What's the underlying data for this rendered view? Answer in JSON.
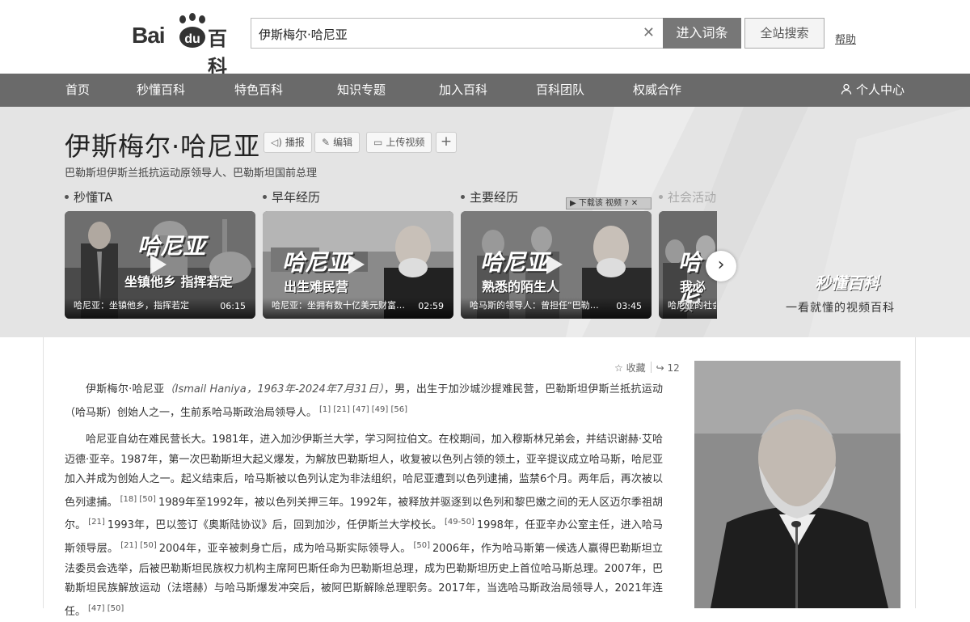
{
  "header": {
    "logo_text_bai": "Bai",
    "logo_text_du": "du",
    "logo_text_baike": "百科",
    "search_value": "伊斯梅尔·哈尼亚",
    "enter_entry_label": "进入词条",
    "site_search_label": "全站搜索",
    "help_label": "帮助"
  },
  "nav": {
    "items": [
      {
        "label": "首页"
      },
      {
        "label": "秒懂百科"
      },
      {
        "label": "特色百科"
      },
      {
        "label": "知识专题"
      },
      {
        "label": "加入百科"
      },
      {
        "label": "百科团队"
      },
      {
        "label": "权威合作"
      }
    ],
    "personal_center": "个人中心"
  },
  "entry": {
    "title": "伊斯梅尔·哈尼亚",
    "tools": {
      "broadcast": "播报",
      "edit": "编辑",
      "upload_video": "上传视频"
    },
    "subtitle": "巴勒斯坦伊斯兰抵抗运动原领导人、巴勒斯坦国前总理"
  },
  "video_section": {
    "tabs": [
      {
        "label": "秒懂TA"
      },
      {
        "label": "早年经历"
      },
      {
        "label": "主要经历"
      },
      {
        "label": "社会活动"
      }
    ],
    "download_ad": "下载该 视频",
    "cards": [
      {
        "overlay_title": "哈尼亚",
        "overlay_sub": "坐镇他乡 指挥若定",
        "caption": "哈尼亚：坐镇他乡，指挥若定",
        "duration": "06:15"
      },
      {
        "overlay_title": "哈尼亚",
        "overlay_sub": "出生难民营",
        "caption": "哈尼亚：坐拥有数十亿美元财富…",
        "duration": "02:59"
      },
      {
        "overlay_title": "哈尼亚",
        "overlay_sub": "熟悉的陌生人",
        "caption": "哈马斯的领导人：曾担任“巴勒…",
        "duration": "03:45"
      },
      {
        "overlay_title": "哈尼",
        "overlay_sub": "我必须",
        "caption": "哈尼亚的社会",
        "duration": ""
      }
    ],
    "brand_name": "秒懂百科",
    "brand_slogan": "一看就懂的视频百科"
  },
  "actions": {
    "favorite_label": "收藏",
    "share_count": "12"
  },
  "paragraphs": {
    "p1": {
      "name": "伊斯梅尔·哈尼亚",
      "en": "（Ismail Haniya，1963年-2024年7月31日）",
      "text": "，男，出生于加沙城沙提难民营，巴勒斯坦伊斯兰抵抗运动（哈马斯）创始人之一，生前系哈马斯政治局领导人。",
      "refs": "[1] [21] [47] [49] [56]"
    },
    "p2": {
      "s1": "哈尼亚自幼在难民营长大。1981年，进入加沙伊斯兰大学，学习阿拉伯文。在校期间，加入穆斯林兄弟会，并结识谢赫·艾哈迈德·亚辛。1987年，第一次巴勒斯坦大起义爆发，为解放巴勒斯坦人，收复被以色列占领的领土，亚辛提议成立哈马斯，哈尼亚加入并成为创始人之一。起义结束后，哈马斯被以色列认定为非法组织，哈尼亚遭到以色列逮捕，监禁6个月。两年后，再次被以色列逮捕。",
      "r1": "[18] [50]",
      "s2": "1989年至1992年，被以色列关押三年。1992年，被释放并驱逐到以色列和黎巴嫩之间的无人区迈尔季祖胡尔。",
      "r2": "[21]",
      "s3": "1993年，巴以签订《奥斯陆协议》后，回到加沙，任伊斯兰大学校长。",
      "r3": "[49-50]",
      "s4": "1998年，任亚辛办公室主任，进入哈马斯领导层。",
      "r4": "[21] [50]",
      "s5": "2004年，亚辛被刺身亡后，成为哈马斯实际领导人。",
      "r5": "[50]",
      "s6": "2006年，作为哈马斯第一候选人赢得巴勒斯坦立法委员会选举，后被巴勒斯坦民族权力机构主席阿巴斯任命为巴勒斯坦总理，成为巴勒斯坦历史上首位哈马斯总理。2007年，巴勒斯坦民族解放运动（法塔赫）与哈马斯爆发冲突后，被阿巴斯解除总理职务。2017年，当选哈马斯政治局领导人，2021年连任。",
      "r6": "[47] [50]"
    }
  },
  "colors": {
    "nav_bg": "#6a6a6a",
    "enter_btn_bg": "#777777",
    "hero_bg": "#e4e4e4"
  }
}
